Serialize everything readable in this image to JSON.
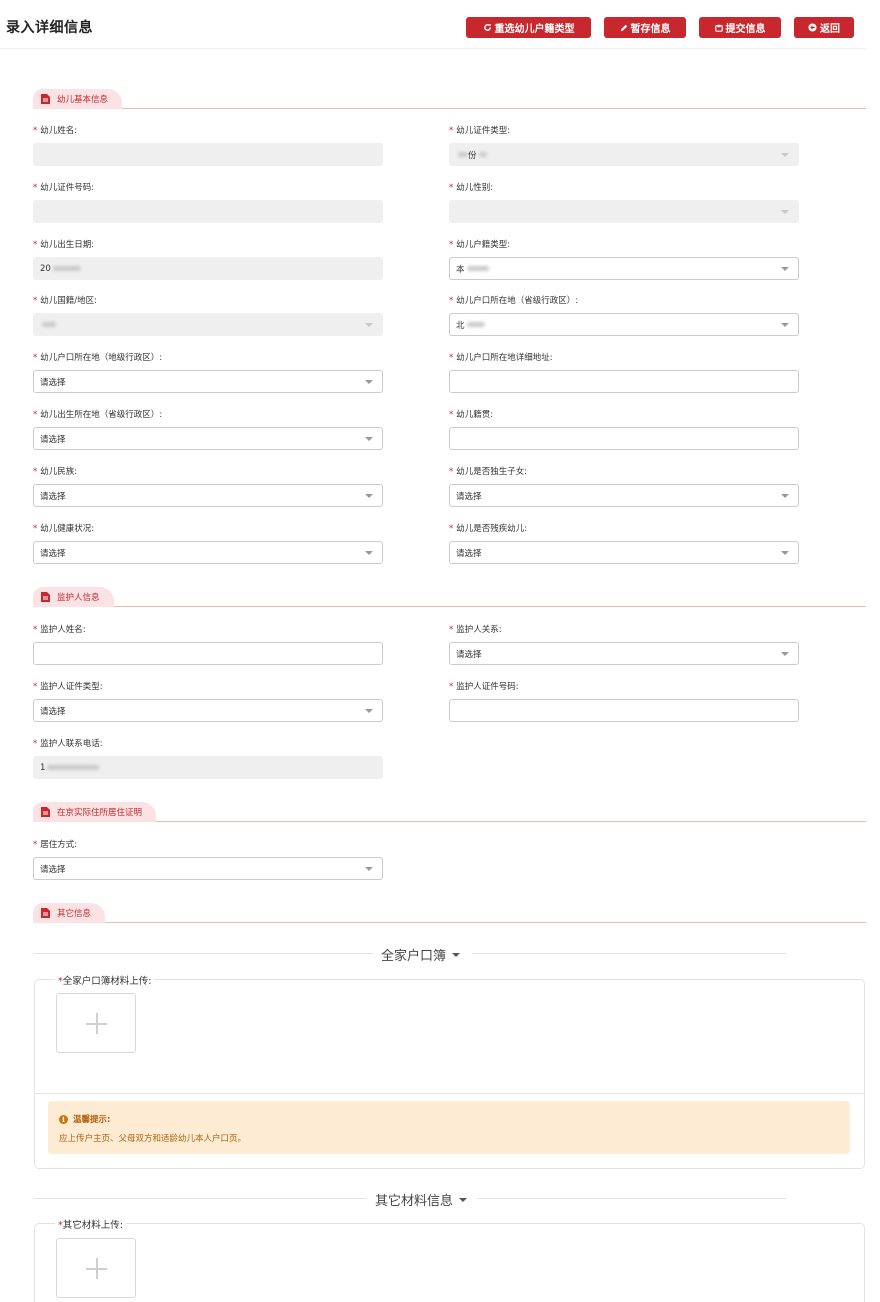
{
  "header": {
    "title": "录入详细信息",
    "buttons": {
      "reselect": "重选幼儿户籍类型",
      "save_draft": "暂存信息",
      "submit": "提交信息",
      "back": "返回"
    }
  },
  "sections": {
    "child_basic": "幼儿基本信息",
    "guardian": "监护人信息",
    "residence": "在京实际住所居住证明",
    "other": "其它信息"
  },
  "child": {
    "name": {
      "label": "幼儿姓名:",
      "value": ""
    },
    "id_type": {
      "label": "幼儿证件类型:",
      "value": "份"
    },
    "id_number": {
      "label": "幼儿证件号码:",
      "value": ""
    },
    "gender": {
      "label": "幼儿性别:",
      "value": ""
    },
    "birth_date": {
      "label": "幼儿出生日期:",
      "value": "20"
    },
    "hukou_type": {
      "label": "幼儿户籍类型:",
      "value": "本"
    },
    "nationality": {
      "label": "幼儿国籍/地区:",
      "value": ""
    },
    "hukou_province": {
      "label": "幼儿户口所在地（省级行政区）:",
      "value": "北"
    },
    "hukou_city": {
      "label": "幼儿户口所在地（地级行政区）:",
      "value": "请选择"
    },
    "hukou_address": {
      "label": "幼儿户口所在地详细地址:",
      "value": ""
    },
    "birth_province": {
      "label": "幼儿出生所在地（省级行政区）:",
      "value": "请选择"
    },
    "native_place": {
      "label": "幼儿籍贯:",
      "value": ""
    },
    "ethnicity": {
      "label": "幼儿民族:",
      "value": "请选择"
    },
    "only_child": {
      "label": "幼儿是否独生子女:",
      "value": "请选择"
    },
    "health": {
      "label": "幼儿健康状况:",
      "value": "请选择"
    },
    "disabled": {
      "label": "幼儿是否残疾幼儿:",
      "value": "请选择"
    }
  },
  "guardian": {
    "name": {
      "label": "监护人姓名:",
      "value": ""
    },
    "relation": {
      "label": "监护人关系:",
      "value": "请选择"
    },
    "id_type": {
      "label": "监护人证件类型:",
      "value": "请选择"
    },
    "id_number": {
      "label": "监护人证件号码:",
      "value": ""
    },
    "phone": {
      "label": "监护人联系电话:",
      "value": "1"
    }
  },
  "residence": {
    "mode": {
      "label": "居住方式:",
      "value": "请选择"
    }
  },
  "other": {
    "household_register": {
      "title": "全家户口簿",
      "upload_label": "全家户口簿材料上传:",
      "notice_title": "温馨提示:",
      "notice_text": "应上传户主页、父母双方和适龄幼儿本人户口页。"
    },
    "other_materials": {
      "title": "其它材料信息",
      "upload_label": "其它材料上传:"
    }
  },
  "colors": {
    "brand": "#c8272d",
    "section_tab_bg": "#fbe3e5",
    "notice_bg": "#fdebd3",
    "notice_text": "#b0620a"
  },
  "icons": {
    "reselect": "refresh-icon",
    "save_draft": "pencil-icon",
    "submit": "submit-icon",
    "back": "arrow-left-icon",
    "section": "document-icon",
    "notice": "info-icon",
    "upload": "plus-icon"
  }
}
